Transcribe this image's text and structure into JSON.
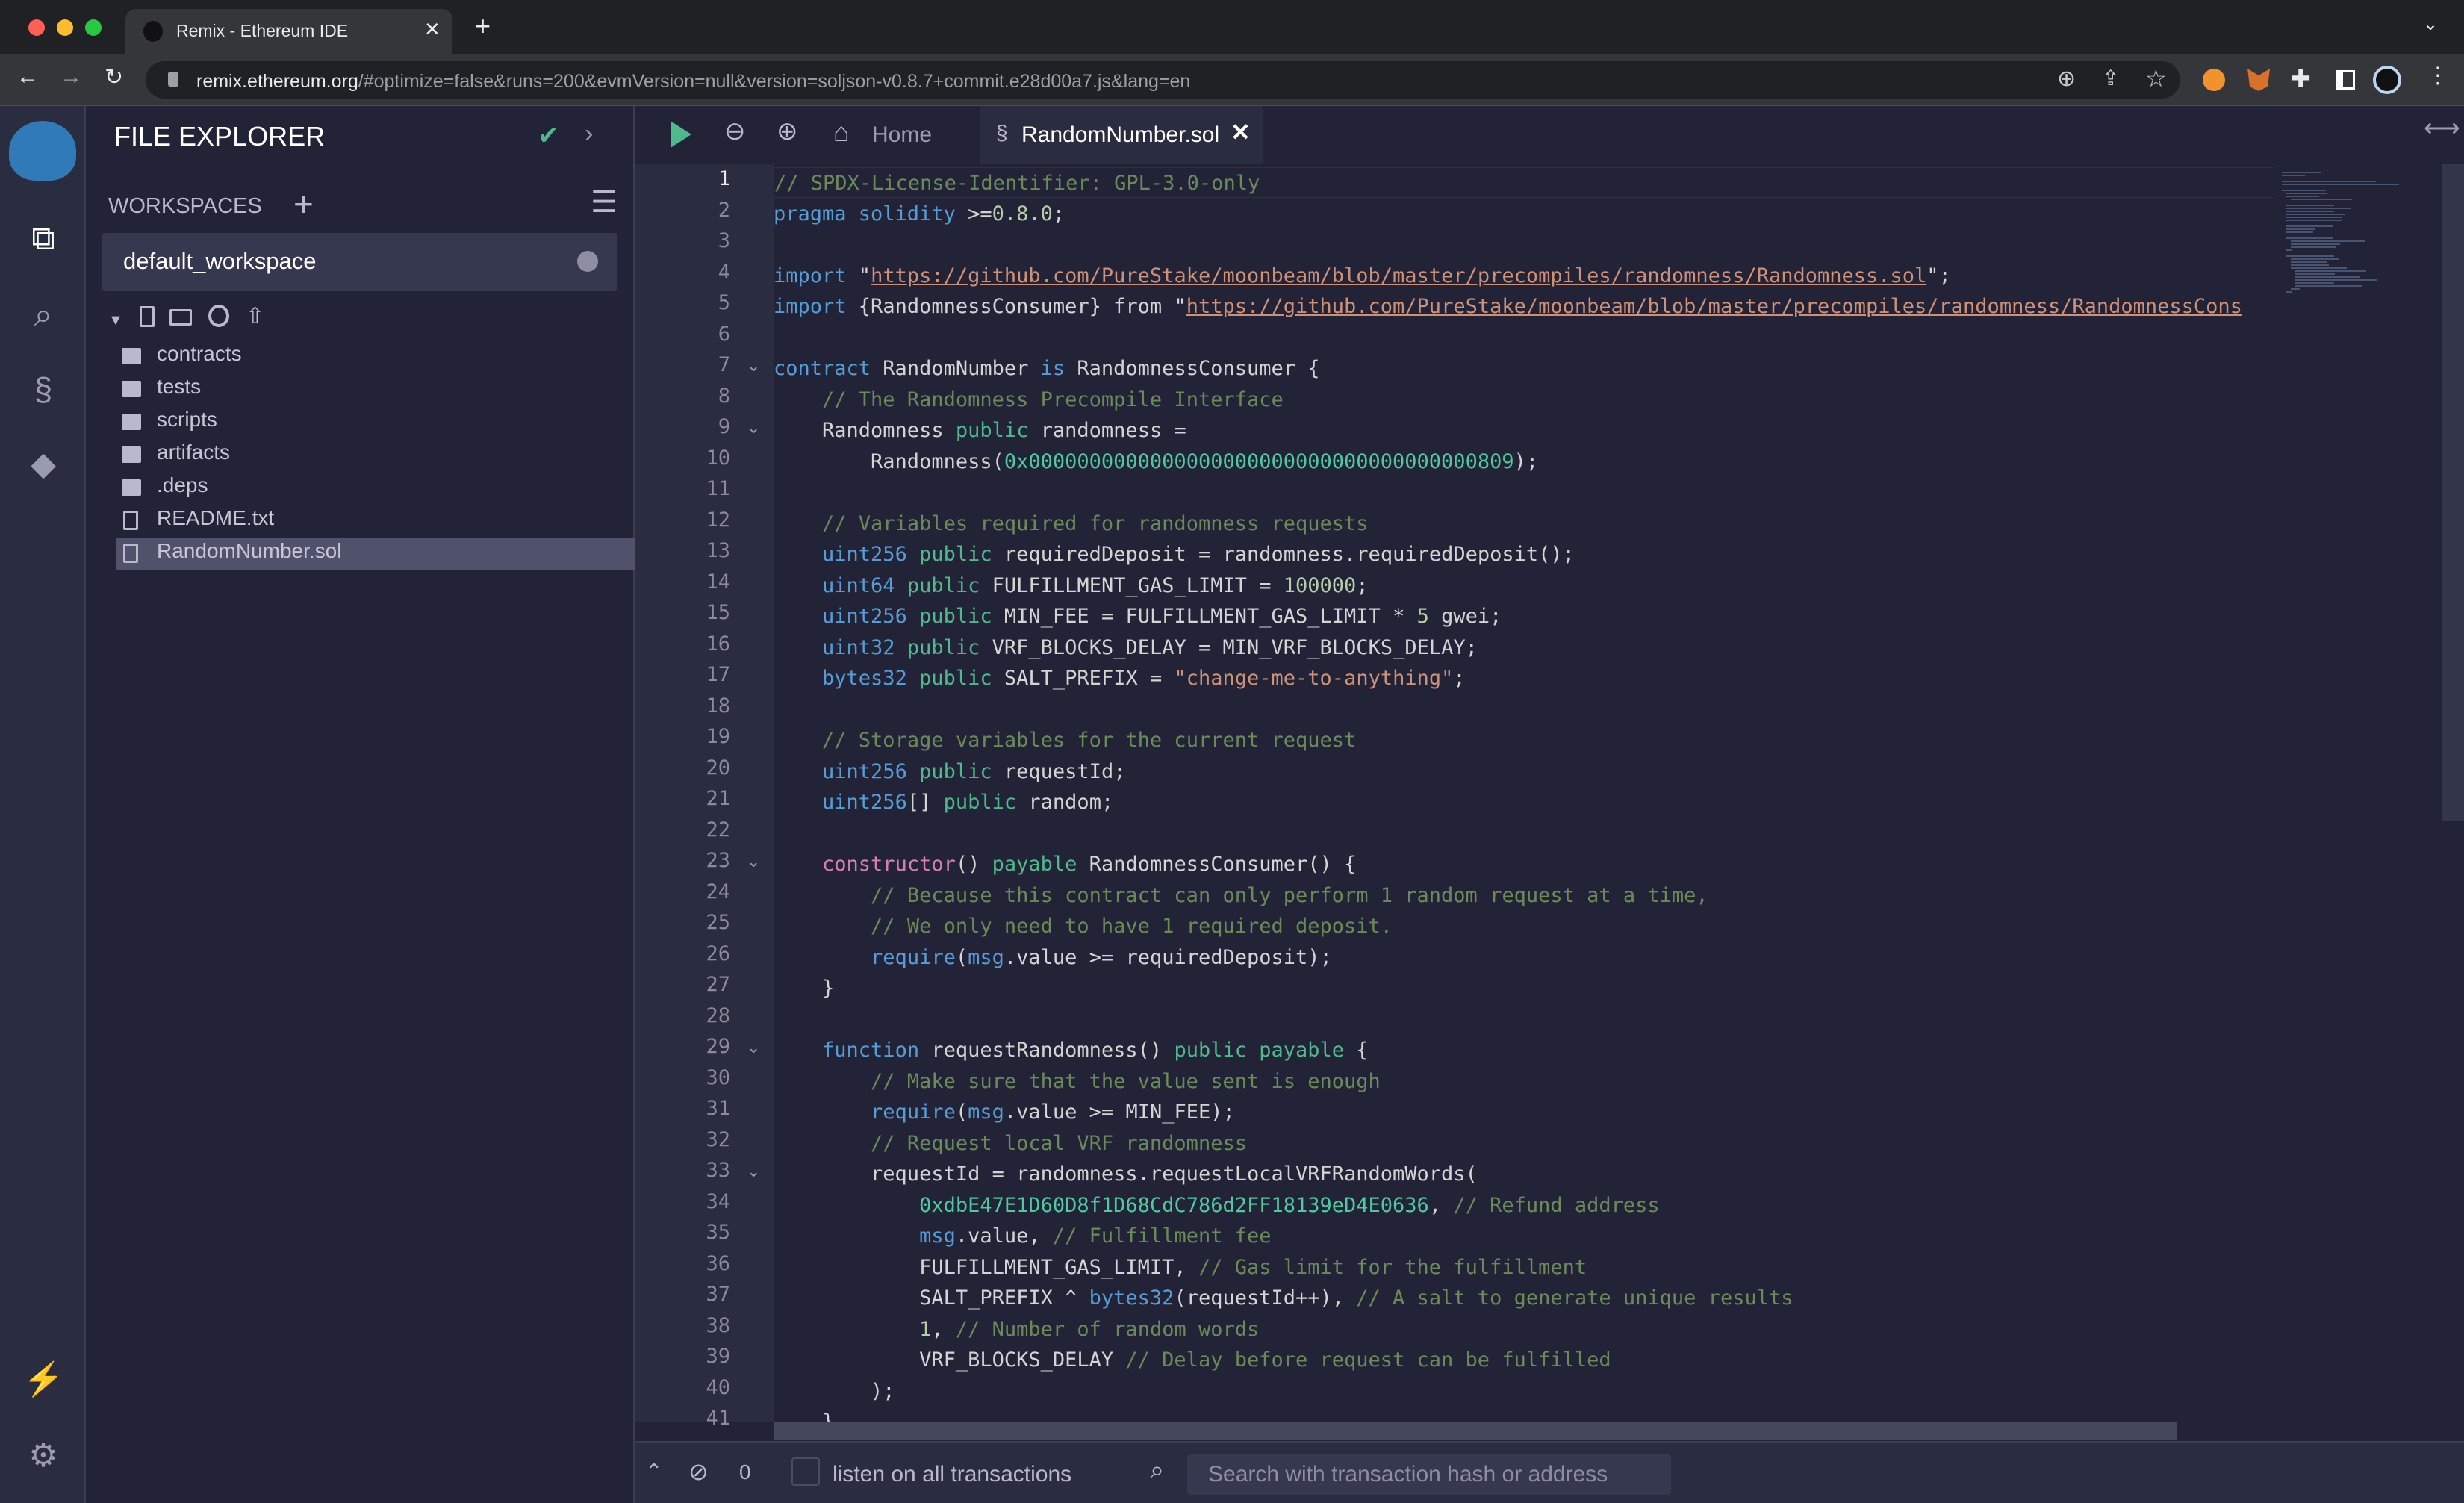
{
  "browser": {
    "tab_title": "Remix - Ethereum IDE",
    "url_host": "remix.ethereum.org",
    "url_rest": "/#optimize=false&runs=200&evmVersion=null&version=soljson-v0.8.7+commit.e28d00a7.js&lang=en"
  },
  "sidebar": {
    "title": "FILE EXPLORER",
    "workspaces_label": "WORKSPACES",
    "workspace": "default_workspace",
    "items": [
      {
        "label": "contracts",
        "type": "folder"
      },
      {
        "label": "tests",
        "type": "folder"
      },
      {
        "label": "scripts",
        "type": "folder"
      },
      {
        "label": "artifacts",
        "type": "folder"
      },
      {
        "label": ".deps",
        "type": "folder"
      },
      {
        "label": "README.txt",
        "type": "file"
      },
      {
        "label": "RandomNumber.sol",
        "type": "solidity",
        "selected": true
      }
    ]
  },
  "editor": {
    "home_tab": "Home",
    "file_tab": "RandomNumber.sol",
    "folded_lines": [
      7,
      9,
      23,
      29,
      33
    ],
    "lines": [
      [
        [
          "c",
          "// SPDX-License-Identifier: GPL-3.0-only"
        ]
      ],
      [
        [
          "k",
          "pragma solidity"
        ],
        [
          "t",
          " >="
        ],
        [
          "n",
          "0.8.0"
        ],
        [
          "t",
          ";"
        ]
      ],
      [],
      [
        [
          "k",
          "import"
        ],
        [
          "t",
          " \""
        ],
        [
          "s",
          "https://github.com/PureStake/moonbeam/blob/master/precompiles/randomness/Randomness.sol"
        ],
        [
          "t",
          "\";"
        ]
      ],
      [
        [
          "k",
          "import"
        ],
        [
          "t",
          " {RandomnessConsumer} from \""
        ],
        [
          "s",
          "https://github.com/PureStake/moonbeam/blob/master/precompiles/randomness/RandomnessCons"
        ]
      ],
      [],
      [
        [
          "k",
          "contract"
        ],
        [
          "t",
          " RandomNumber "
        ],
        [
          "k",
          "is"
        ],
        [
          "t",
          " RandomnessConsumer {"
        ]
      ],
      [
        [
          "t",
          "    "
        ],
        [
          "c",
          "// The Randomness Precompile Interface"
        ]
      ],
      [
        [
          "t",
          "    Randomness "
        ],
        [
          "g",
          "public"
        ],
        [
          "t",
          " randomness ="
        ]
      ],
      [
        [
          "t",
          "        Randomness("
        ],
        [
          "h",
          "0x0000000000000000000000000000000000000809"
        ],
        [
          "t",
          ");"
        ]
      ],
      [],
      [
        [
          "t",
          "    "
        ],
        [
          "c",
          "// Variables required for randomness requests"
        ]
      ],
      [
        [
          "t",
          "    "
        ],
        [
          "k",
          "uint256"
        ],
        [
          "t",
          " "
        ],
        [
          "g",
          "public"
        ],
        [
          "t",
          " requiredDeposit = randomness.requiredDeposit();"
        ]
      ],
      [
        [
          "t",
          "    "
        ],
        [
          "k",
          "uint64"
        ],
        [
          "t",
          " "
        ],
        [
          "g",
          "public"
        ],
        [
          "t",
          " FULFILLMENT_GAS_LIMIT = "
        ],
        [
          "n",
          "100000"
        ],
        [
          "t",
          ";"
        ]
      ],
      [
        [
          "t",
          "    "
        ],
        [
          "k",
          "uint256"
        ],
        [
          "t",
          " "
        ],
        [
          "g",
          "public"
        ],
        [
          "t",
          " MIN_FEE = FULFILLMENT_GAS_LIMIT * "
        ],
        [
          "n",
          "5"
        ],
        [
          "t",
          " gwei;"
        ]
      ],
      [
        [
          "t",
          "    "
        ],
        [
          "k",
          "uint32"
        ],
        [
          "t",
          " "
        ],
        [
          "g",
          "public"
        ],
        [
          "t",
          " VRF_BLOCKS_DELAY = MIN_VRF_BLOCKS_DELAY;"
        ]
      ],
      [
        [
          "t",
          "    "
        ],
        [
          "k",
          "bytes32"
        ],
        [
          "t",
          " "
        ],
        [
          "g",
          "public"
        ],
        [
          "t",
          " SALT_PREFIX = "
        ],
        [
          "q",
          "\"change-me-to-anything\""
        ],
        [
          "t",
          ";"
        ]
      ],
      [],
      [
        [
          "t",
          "    "
        ],
        [
          "c",
          "// Storage variables for the current request"
        ]
      ],
      [
        [
          "t",
          "    "
        ],
        [
          "k",
          "uint256"
        ],
        [
          "t",
          " "
        ],
        [
          "g",
          "public"
        ],
        [
          "t",
          " requestId;"
        ]
      ],
      [
        [
          "t",
          "    "
        ],
        [
          "k",
          "uint256"
        ],
        [
          "t",
          "[] "
        ],
        [
          "g",
          "public"
        ],
        [
          "t",
          " random;"
        ]
      ],
      [],
      [
        [
          "t",
          "    "
        ],
        [
          "m",
          "constructor"
        ],
        [
          "t",
          "() "
        ],
        [
          "g",
          "payable"
        ],
        [
          "t",
          " RandomnessConsumer() {"
        ]
      ],
      [
        [
          "t",
          "        "
        ],
        [
          "c",
          "// Because this contract can only perform 1 random request at a time,"
        ]
      ],
      [
        [
          "t",
          "        "
        ],
        [
          "c",
          "// We only need to have 1 required deposit."
        ]
      ],
      [
        [
          "t",
          "        "
        ],
        [
          "k",
          "require"
        ],
        [
          "t",
          "("
        ],
        [
          "k",
          "msg"
        ],
        [
          "t",
          ".value >= requiredDeposit);"
        ]
      ],
      [
        [
          "t",
          "    }"
        ]
      ],
      [],
      [
        [
          "t",
          "    "
        ],
        [
          "k",
          "function"
        ],
        [
          "t",
          " requestRandomness() "
        ],
        [
          "g",
          "public payable"
        ],
        [
          "t",
          " {"
        ]
      ],
      [
        [
          "t",
          "        "
        ],
        [
          "c",
          "// Make sure that the value sent is enough"
        ]
      ],
      [
        [
          "t",
          "        "
        ],
        [
          "k",
          "require"
        ],
        [
          "t",
          "("
        ],
        [
          "k",
          "msg"
        ],
        [
          "t",
          ".value >= MIN_FEE);"
        ]
      ],
      [
        [
          "t",
          "        "
        ],
        [
          "c",
          "// Request local VRF randomness"
        ]
      ],
      [
        [
          "t",
          "        requestId = randomness.requestLocalVRFRandomWords("
        ]
      ],
      [
        [
          "t",
          "            "
        ],
        [
          "h",
          "0xdbE47E1D60D8f1D68CdC786d2FF18139eD4E0636"
        ],
        [
          "t",
          ", "
        ],
        [
          "c",
          "// Refund address"
        ]
      ],
      [
        [
          "t",
          "            "
        ],
        [
          "k",
          "msg"
        ],
        [
          "t",
          ".value, "
        ],
        [
          "c",
          "// Fulfillment fee"
        ]
      ],
      [
        [
          "t",
          "            FULFILLMENT_GAS_LIMIT, "
        ],
        [
          "c",
          "// Gas limit for the fulfillment"
        ]
      ],
      [
        [
          "t",
          "            SALT_PREFIX ^ "
        ],
        [
          "k",
          "bytes32"
        ],
        [
          "t",
          "(requestId++), "
        ],
        [
          "c",
          "// A salt to generate unique results"
        ]
      ],
      [
        [
          "t",
          "            "
        ],
        [
          "n",
          "1"
        ],
        [
          "t",
          ", "
        ],
        [
          "c",
          "// Number of random words"
        ]
      ],
      [
        [
          "t",
          "            VRF_BLOCKS_DELAY "
        ],
        [
          "c",
          "// Delay before request can be fulfilled"
        ]
      ],
      [
        [
          "t",
          "        );"
        ]
      ],
      [
        [
          "t",
          "    }"
        ]
      ]
    ]
  },
  "terminal": {
    "pending_count": "0",
    "listen_label": "listen on all transactions",
    "listen_checked": false,
    "search_placeholder": "Search with transaction hash or address"
  },
  "colors": {
    "accent": "#4fb88c",
    "keyword": "#569cd6",
    "string": "#ce9178",
    "comment": "#6b8a5a"
  }
}
